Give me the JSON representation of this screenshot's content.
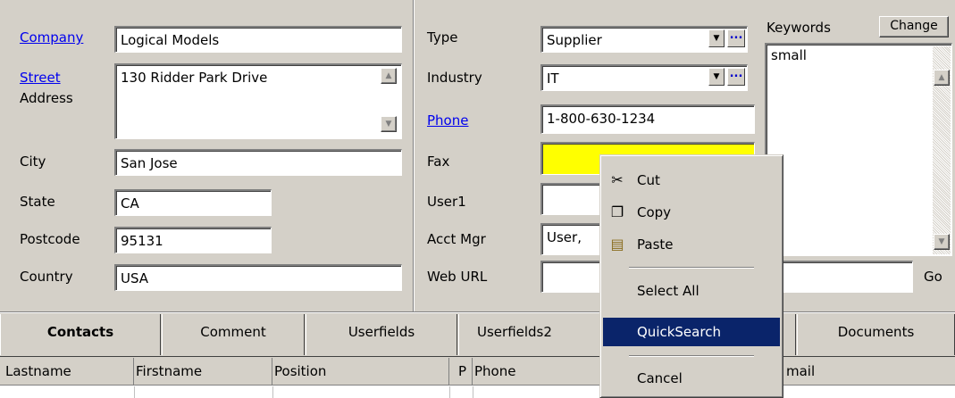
{
  "left": {
    "company_label": "Company",
    "company_value": "Logical Models",
    "street_label": "Street",
    "address_label": "Address",
    "street_value": "130 Ridder Park Drive",
    "city_label": "City",
    "city_value": "San Jose",
    "state_label": "State",
    "state_value": "CA",
    "postcode_label": "Postcode",
    "postcode_value": "95131",
    "country_label": "Country",
    "country_value": "USA"
  },
  "middle": {
    "type_label": "Type",
    "type_value": "Supplier",
    "industry_label": "Industry",
    "industry_value": "IT",
    "phone_label": "Phone",
    "phone_value": "1-800-630-1234",
    "fax_label": "Fax",
    "fax_value": "",
    "user1_label": "User1",
    "user1_value": "",
    "acctmgr_label": "Acct Mgr",
    "acctmgr_value": "User,",
    "weburl_label": "Web URL",
    "weburl_value": "",
    "go_label": "Go"
  },
  "right": {
    "keywords_label": "Keywords",
    "change_label": "Change",
    "keywords_value": "small"
  },
  "tabs": [
    {
      "label": "Contacts",
      "active": true
    },
    {
      "label": "Comment"
    },
    {
      "label": "Userfields"
    },
    {
      "label": "Userfields2"
    },
    {
      "label": "Documents"
    }
  ],
  "grid": {
    "headers": [
      "Lastname",
      "Firstname",
      "Position",
      "P",
      "Phone",
      "mail"
    ]
  },
  "context_menu": {
    "items": [
      {
        "label": "Cut",
        "icon": "scissors-icon"
      },
      {
        "label": "Copy",
        "icon": "copy-icon"
      },
      {
        "label": "Paste",
        "icon": "paste-icon"
      },
      {
        "label": "Select All"
      },
      {
        "label": "QuickSearch",
        "highlighted": true
      },
      {
        "label": "Cancel"
      }
    ],
    "highlight_color": "#0a246a"
  },
  "colors": {
    "background": "#d4d0c8",
    "link": "#0000ee",
    "fax_field": "#ffff00"
  }
}
